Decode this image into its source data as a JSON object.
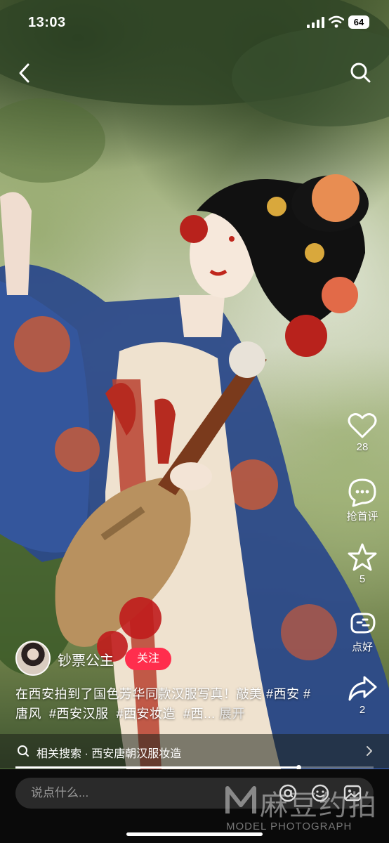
{
  "status_bar": {
    "time": "13:03",
    "battery": "64"
  },
  "post": {
    "author": "钞票公主",
    "follow_label": "关注",
    "caption_text": "在西安拍到了国色芳华同款汉服写真！敲美 #西安 ",
    "tags": [
      "#唐风",
      "#西安汉服",
      "#西安妆造",
      "#西..."
    ],
    "expand_label": "展开"
  },
  "actions": {
    "like_count": "28",
    "comment_label": "抢首评",
    "collect_count": "5",
    "share_like_label": "点好",
    "share_count": "2"
  },
  "related_search": {
    "text": "相关搜索 · 西安唐朝汉服妆造"
  },
  "progress": {
    "fraction": 0.79
  },
  "comment_bar": {
    "placeholder": "说点什么..."
  },
  "watermark": {
    "big": "麻豆约拍",
    "small": "MODEL PHOTOGRAPH"
  },
  "colors": {
    "follow": "#ff2e4d",
    "background": "#000000"
  },
  "icons": [
    "back-icon",
    "search-icon",
    "heart-icon",
    "comment-icon",
    "star-icon",
    "like-hand-icon",
    "share-icon",
    "at-icon",
    "emoji-icon",
    "image-icon",
    "chevron-right-icon"
  ]
}
